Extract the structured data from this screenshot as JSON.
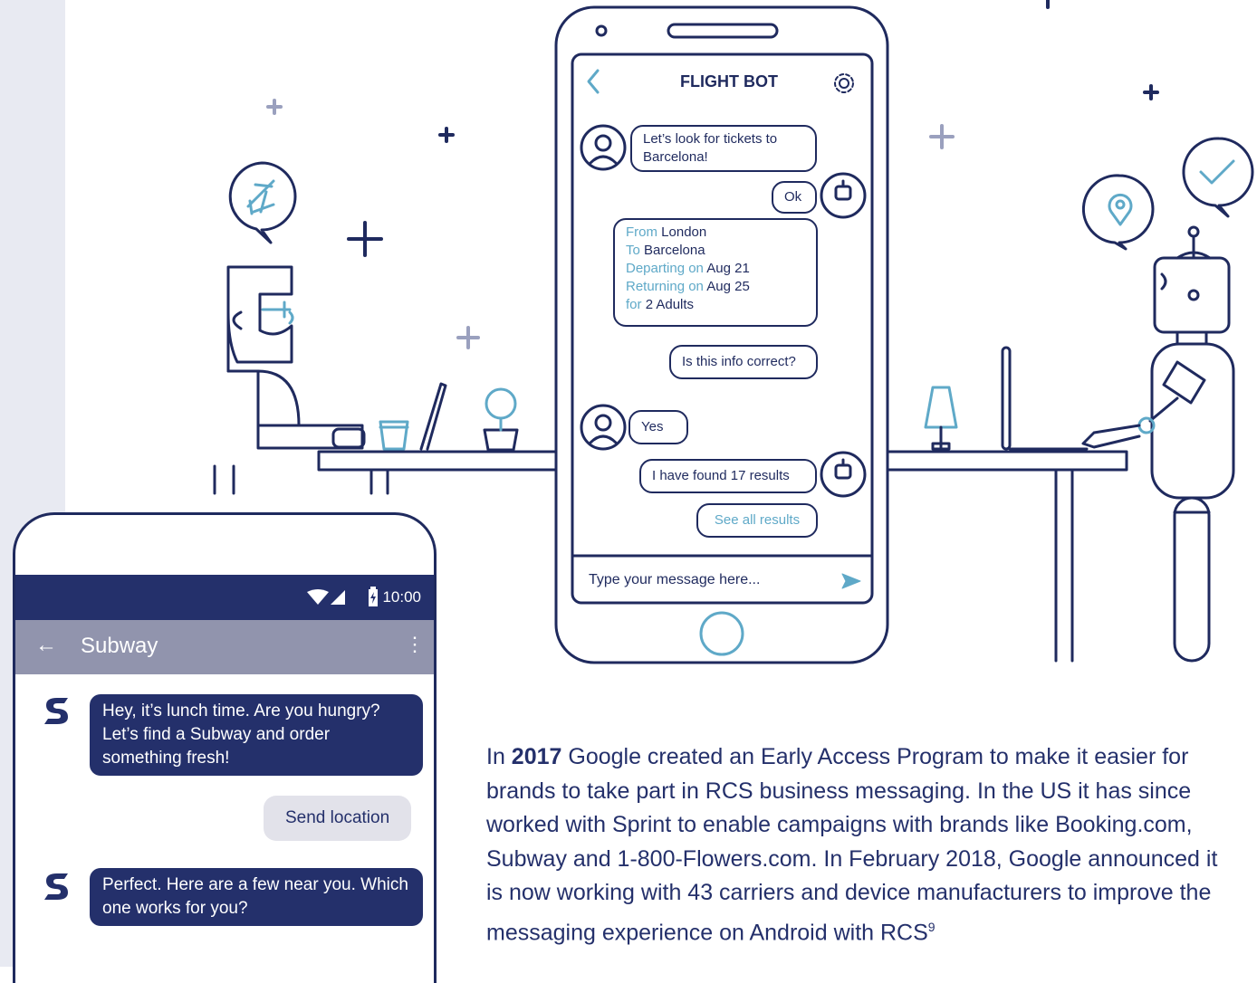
{
  "flight_bot": {
    "title": "FLIGHT BOT",
    "messages": {
      "user_1": "Let’s look for tickets to Barcelona!",
      "bot_ok": "Ok",
      "summary": {
        "from_label": "From",
        "from_value": "London",
        "to_label": "To",
        "to_value": "Barcelona",
        "depart_label": "Departing on",
        "depart_value": "Aug 21",
        "return_label": "Returning on",
        "return_value": "Aug 25",
        "for_label": "for",
        "for_value": "2 Adults"
      },
      "confirm": "Is this info correct?",
      "user_yes": "Yes",
      "results": "I have found 17 results",
      "see_all": "See all results"
    },
    "input_placeholder": "Type your message here..."
  },
  "subway_phone": {
    "time": "10:00",
    "back_icon": "←",
    "title": "Subway",
    "more_icon": "⋮",
    "messages": {
      "bot_1": "Hey, it’s lunch time. Are you hungry? Let’s find a Subway and order something fresh!",
      "reply": "Send location",
      "bot_2": "Perfect. Here are a few near you. Which one works for you?"
    }
  },
  "paragraph": {
    "intro": "In ",
    "year": "2017",
    "body": " Google created an Early Access Program to make it easier for brands to take part in RCS business messaging. In the US it has since worked with Sprint to enable campaigns with brands like Booking.com, Subway and 1-800-Flowers.com. In February 2018, Google announced it is now working with 43 carriers and device manufacturers to improve the messaging experience on Android with RCS",
    "footnote": "9"
  },
  "colors": {
    "navy": "#1f2a5e",
    "accent": "#5fa9c8",
    "sidebar": "#e8eaf2"
  }
}
